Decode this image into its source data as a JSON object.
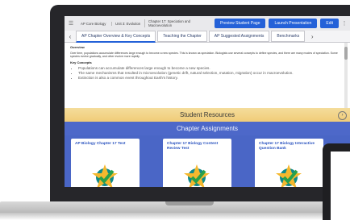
{
  "topbar": {
    "breadcrumbs": [
      "AP Core Biology",
      "Unit 3: Evolution",
      "Chapter 17: Speciation and Macroevolution"
    ],
    "preview_label": "Preview Student Page",
    "launch_label": "Launch Presentation",
    "edit_label": "Edit"
  },
  "tabs": [
    "AP Chapter Overview & Key Concepts",
    "Teaching the Chapter",
    "AP Suggested Assignments",
    "Benchmarks"
  ],
  "overview": {
    "heading": "Overview",
    "text": "Over time, populations accumulate differences large enough to become a new species. This is known as speciation. Biologists use several concepts to define species, and there are many modes of speciation. Some species evolve gradually, and other evolve more rapidly."
  },
  "key_concepts": {
    "heading": "Key Concepts",
    "items": [
      "Populations can accumulate differences large enough to become a new species.",
      "The same mechanisms that resulted in microevolution (genetic drift, natural selection, mutation, migration) occur in macroevolution.",
      "Extinction is also a common event throughout Earth's history."
    ]
  },
  "resources_label": "Student Resources",
  "assignments": {
    "title": "Chapter Assignments",
    "cards": [
      "AP Biology Chapter 17 Test",
      "Chapter 17 Biology Content Review Test",
      "Chapter 17 Biology Interactive Question Bank"
    ]
  },
  "colors": {
    "primary_button": "#2461d8",
    "assign_band": "#4d68c9",
    "resources_band": "#f0cc78"
  }
}
